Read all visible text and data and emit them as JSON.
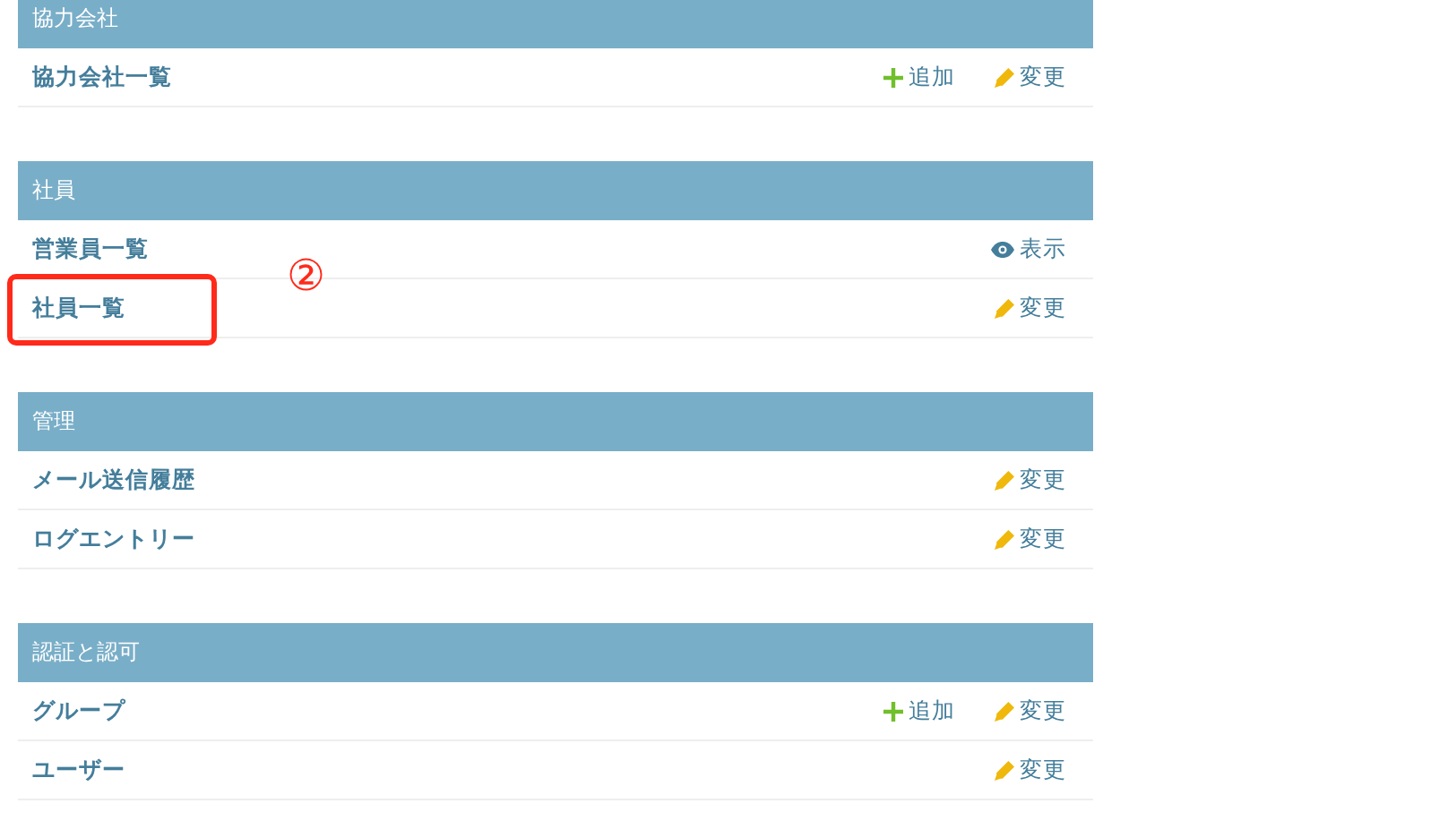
{
  "modules": [
    {
      "title": "協力会社",
      "rows": [
        {
          "name": "協力会社一覧",
          "highlighted": false,
          "actions": [
            {
              "kind": "add",
              "label": "追加"
            },
            {
              "kind": "change",
              "label": "変更"
            }
          ]
        }
      ]
    },
    {
      "title": "社員",
      "rows": [
        {
          "name": "営業員一覧",
          "highlighted": false,
          "actions": [
            {
              "kind": "view",
              "label": "表示"
            }
          ]
        },
        {
          "name": "社員一覧",
          "highlighted": true,
          "marker": "②",
          "actions": [
            {
              "kind": "change",
              "label": "変更"
            }
          ]
        }
      ]
    },
    {
      "title": "管理",
      "rows": [
        {
          "name": "メール送信履歴",
          "highlighted": false,
          "actions": [
            {
              "kind": "change",
              "label": "変更"
            }
          ]
        },
        {
          "name": "ログエントリー",
          "highlighted": false,
          "actions": [
            {
              "kind": "change",
              "label": "変更"
            }
          ]
        }
      ]
    },
    {
      "title": "認証と認可",
      "rows": [
        {
          "name": "グループ",
          "highlighted": false,
          "actions": [
            {
              "kind": "add",
              "label": "追加"
            },
            {
              "kind": "change",
              "label": "変更"
            }
          ]
        },
        {
          "name": "ユーザー",
          "highlighted": false,
          "actions": [
            {
              "kind": "change",
              "label": "変更"
            }
          ]
        }
      ]
    }
  ]
}
